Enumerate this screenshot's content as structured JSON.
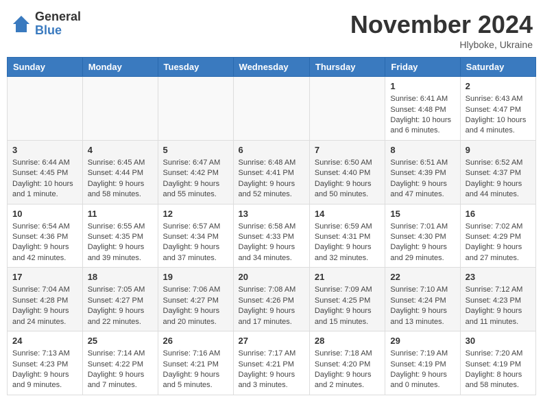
{
  "header": {
    "logo_general": "General",
    "logo_blue": "Blue",
    "month_title": "November 2024",
    "location": "Hlyboke, Ukraine"
  },
  "weekdays": [
    "Sunday",
    "Monday",
    "Tuesday",
    "Wednesday",
    "Thursday",
    "Friday",
    "Saturday"
  ],
  "weeks": [
    [
      {
        "day": "",
        "info": ""
      },
      {
        "day": "",
        "info": ""
      },
      {
        "day": "",
        "info": ""
      },
      {
        "day": "",
        "info": ""
      },
      {
        "day": "",
        "info": ""
      },
      {
        "day": "1",
        "info": "Sunrise: 6:41 AM\nSunset: 4:48 PM\nDaylight: 10 hours and 6 minutes."
      },
      {
        "day": "2",
        "info": "Sunrise: 6:43 AM\nSunset: 4:47 PM\nDaylight: 10 hours and 4 minutes."
      }
    ],
    [
      {
        "day": "3",
        "info": "Sunrise: 6:44 AM\nSunset: 4:45 PM\nDaylight: 10 hours and 1 minute."
      },
      {
        "day": "4",
        "info": "Sunrise: 6:45 AM\nSunset: 4:44 PM\nDaylight: 9 hours and 58 minutes."
      },
      {
        "day": "5",
        "info": "Sunrise: 6:47 AM\nSunset: 4:42 PM\nDaylight: 9 hours and 55 minutes."
      },
      {
        "day": "6",
        "info": "Sunrise: 6:48 AM\nSunset: 4:41 PM\nDaylight: 9 hours and 52 minutes."
      },
      {
        "day": "7",
        "info": "Sunrise: 6:50 AM\nSunset: 4:40 PM\nDaylight: 9 hours and 50 minutes."
      },
      {
        "day": "8",
        "info": "Sunrise: 6:51 AM\nSunset: 4:39 PM\nDaylight: 9 hours and 47 minutes."
      },
      {
        "day": "9",
        "info": "Sunrise: 6:52 AM\nSunset: 4:37 PM\nDaylight: 9 hours and 44 minutes."
      }
    ],
    [
      {
        "day": "10",
        "info": "Sunrise: 6:54 AM\nSunset: 4:36 PM\nDaylight: 9 hours and 42 minutes."
      },
      {
        "day": "11",
        "info": "Sunrise: 6:55 AM\nSunset: 4:35 PM\nDaylight: 9 hours and 39 minutes."
      },
      {
        "day": "12",
        "info": "Sunrise: 6:57 AM\nSunset: 4:34 PM\nDaylight: 9 hours and 37 minutes."
      },
      {
        "day": "13",
        "info": "Sunrise: 6:58 AM\nSunset: 4:33 PM\nDaylight: 9 hours and 34 minutes."
      },
      {
        "day": "14",
        "info": "Sunrise: 6:59 AM\nSunset: 4:31 PM\nDaylight: 9 hours and 32 minutes."
      },
      {
        "day": "15",
        "info": "Sunrise: 7:01 AM\nSunset: 4:30 PM\nDaylight: 9 hours and 29 minutes."
      },
      {
        "day": "16",
        "info": "Sunrise: 7:02 AM\nSunset: 4:29 PM\nDaylight: 9 hours and 27 minutes."
      }
    ],
    [
      {
        "day": "17",
        "info": "Sunrise: 7:04 AM\nSunset: 4:28 PM\nDaylight: 9 hours and 24 minutes."
      },
      {
        "day": "18",
        "info": "Sunrise: 7:05 AM\nSunset: 4:27 PM\nDaylight: 9 hours and 22 minutes."
      },
      {
        "day": "19",
        "info": "Sunrise: 7:06 AM\nSunset: 4:27 PM\nDaylight: 9 hours and 20 minutes."
      },
      {
        "day": "20",
        "info": "Sunrise: 7:08 AM\nSunset: 4:26 PM\nDaylight: 9 hours and 17 minutes."
      },
      {
        "day": "21",
        "info": "Sunrise: 7:09 AM\nSunset: 4:25 PM\nDaylight: 9 hours and 15 minutes."
      },
      {
        "day": "22",
        "info": "Sunrise: 7:10 AM\nSunset: 4:24 PM\nDaylight: 9 hours and 13 minutes."
      },
      {
        "day": "23",
        "info": "Sunrise: 7:12 AM\nSunset: 4:23 PM\nDaylight: 9 hours and 11 minutes."
      }
    ],
    [
      {
        "day": "24",
        "info": "Sunrise: 7:13 AM\nSunset: 4:23 PM\nDaylight: 9 hours and 9 minutes."
      },
      {
        "day": "25",
        "info": "Sunrise: 7:14 AM\nSunset: 4:22 PM\nDaylight: 9 hours and 7 minutes."
      },
      {
        "day": "26",
        "info": "Sunrise: 7:16 AM\nSunset: 4:21 PM\nDaylight: 9 hours and 5 minutes."
      },
      {
        "day": "27",
        "info": "Sunrise: 7:17 AM\nSunset: 4:21 PM\nDaylight: 9 hours and 3 minutes."
      },
      {
        "day": "28",
        "info": "Sunrise: 7:18 AM\nSunset: 4:20 PM\nDaylight: 9 hours and 2 minutes."
      },
      {
        "day": "29",
        "info": "Sunrise: 7:19 AM\nSunset: 4:19 PM\nDaylight: 9 hours and 0 minutes."
      },
      {
        "day": "30",
        "info": "Sunrise: 7:20 AM\nSunset: 4:19 PM\nDaylight: 8 hours and 58 minutes."
      }
    ]
  ]
}
